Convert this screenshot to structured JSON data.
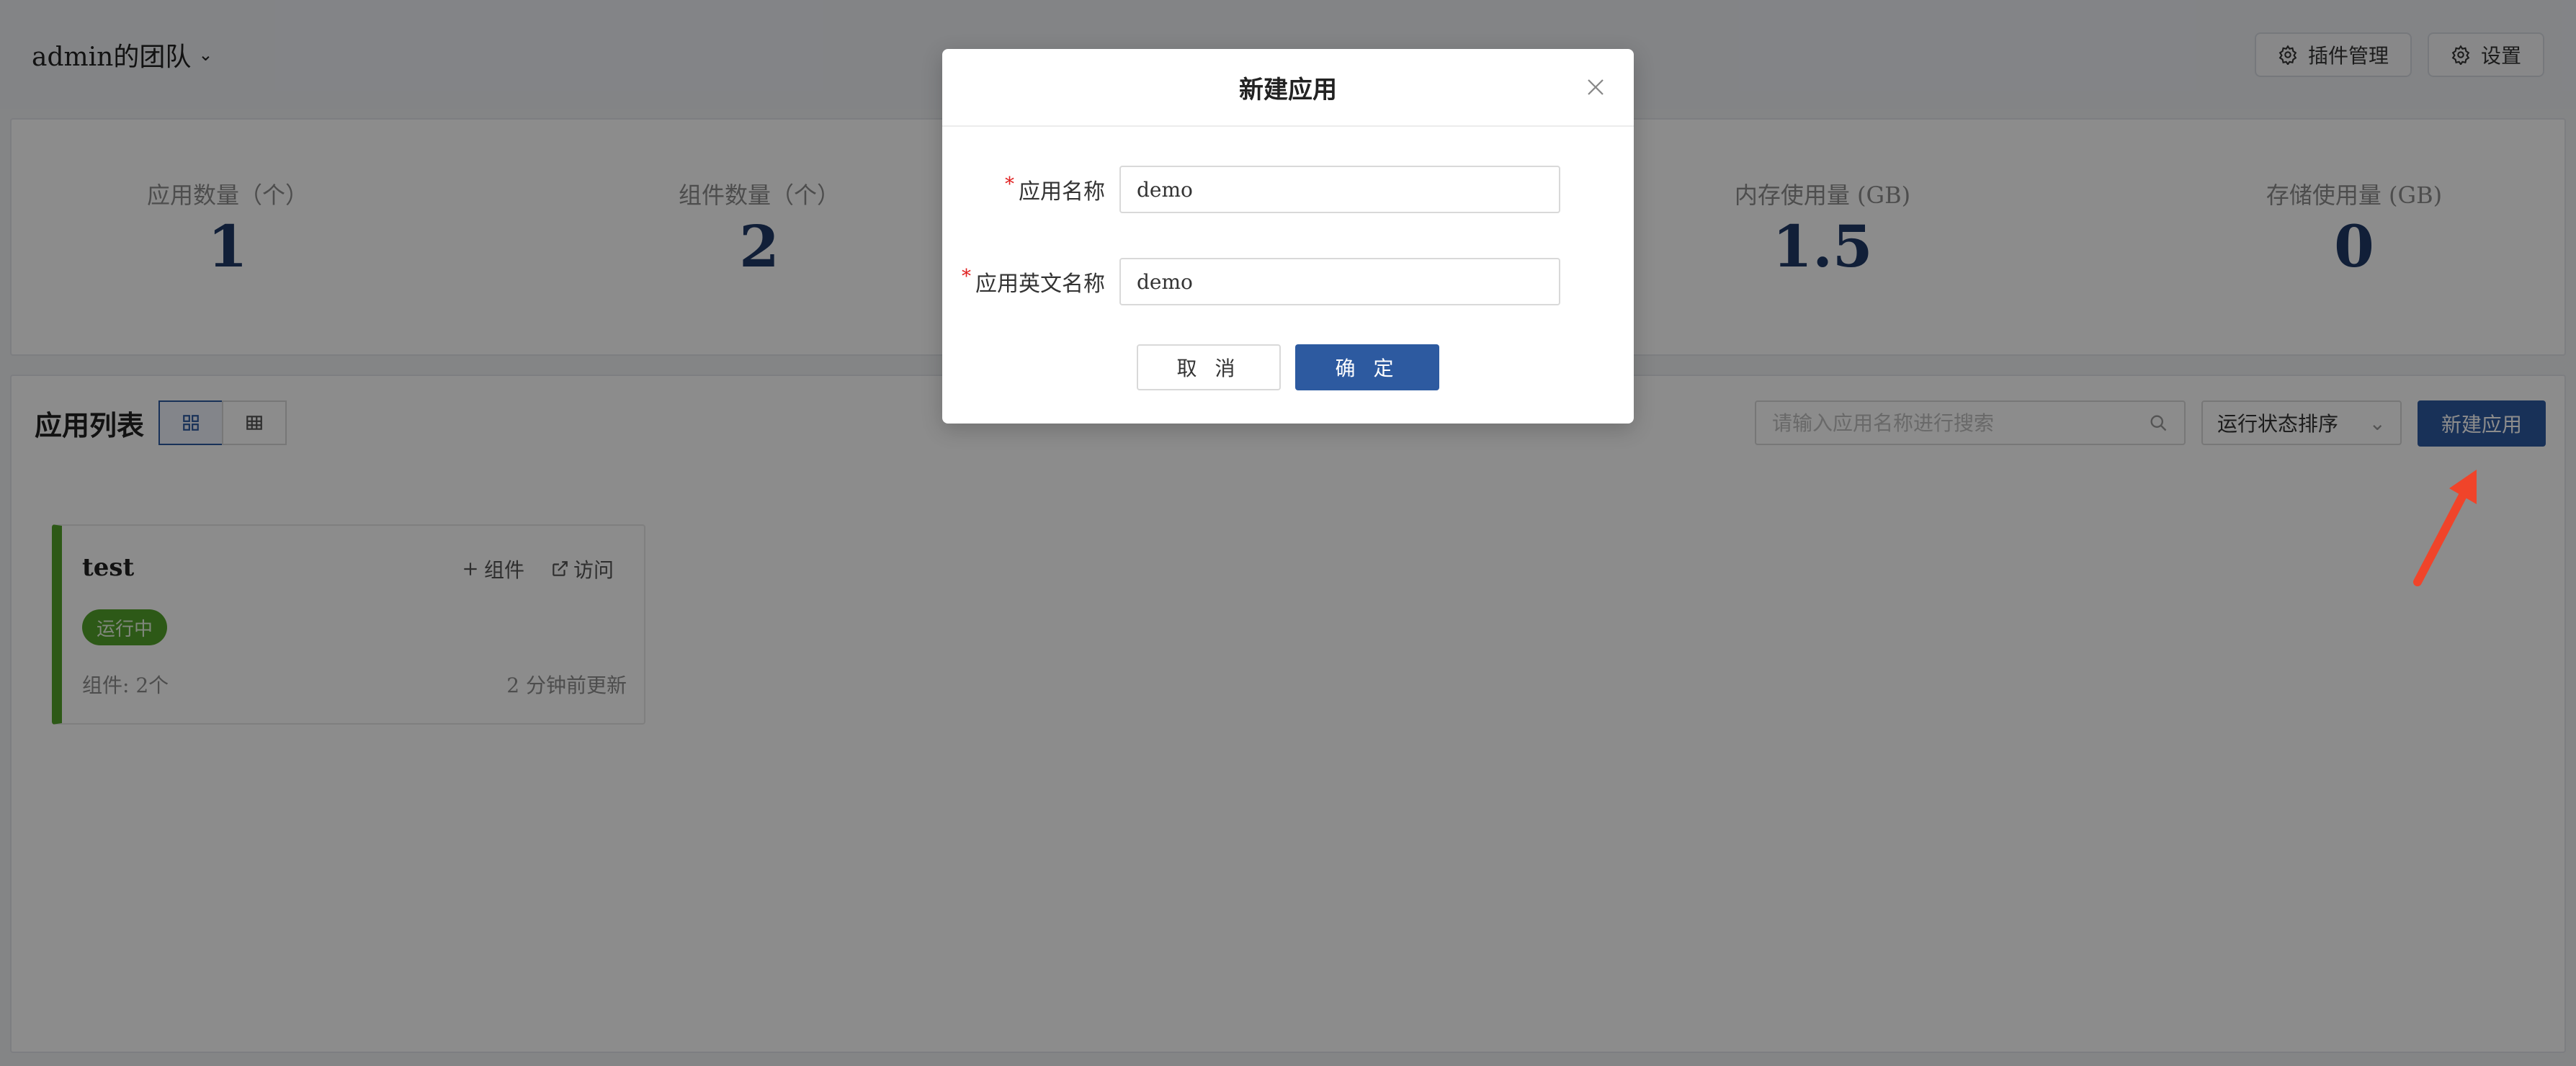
{
  "header": {
    "team_name": "admin的团队",
    "plugin_btn": "插件管理",
    "settings_btn": "设置"
  },
  "stats": [
    {
      "label": "应用数量（个）",
      "value": "1"
    },
    {
      "label": "组件数量（个）",
      "value": "2"
    },
    {
      "label": "内存使用量 (GB)",
      "value": "1.5"
    },
    {
      "label": "存储使用量 (GB)",
      "value": "0"
    }
  ],
  "list": {
    "title": "应用列表",
    "search_placeholder": "请输入应用名称进行搜索",
    "sort_label": "运行状态排序",
    "new_app_label": "新建应用"
  },
  "apps": [
    {
      "name": "test",
      "add_component": "组件",
      "visit": "访问",
      "status": "运行中",
      "components": "组件: 2个",
      "updated": "2 分钟前更新"
    }
  ],
  "modal": {
    "title": "新建应用",
    "name_label": "应用名称",
    "name_value": "demo",
    "en_name_label": "应用英文名称",
    "en_name_value": "demo",
    "cancel": "取 消",
    "ok": "确 定",
    "required_mark": "*"
  },
  "colors": {
    "primary": "#2d5aa0",
    "running": "#52a32a",
    "annotation": "#f0442a"
  }
}
